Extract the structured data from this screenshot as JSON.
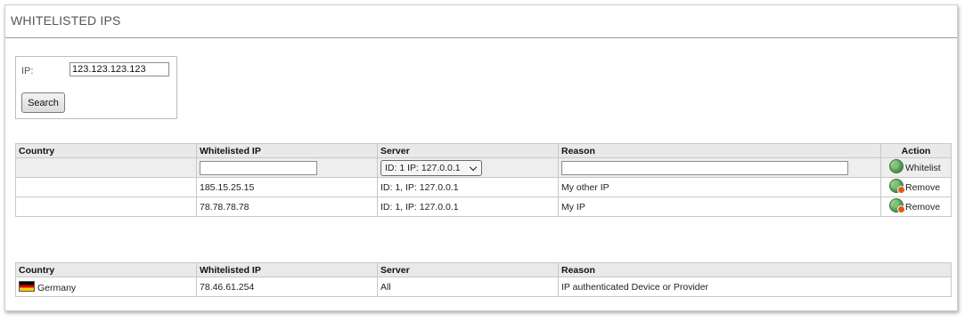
{
  "panel": {
    "title": "WHITELISTED IPS"
  },
  "search": {
    "ip_label": "IP:",
    "ip_value": "123.123.123.123",
    "button_label": "Search"
  },
  "whitelist_table": {
    "headers": {
      "country": "Country",
      "ip": "Whitelisted IP",
      "server": "Server",
      "reason": "Reason",
      "action": "Action"
    },
    "filter_row": {
      "ip_value": "",
      "server_selected": "ID: 1 IP: 127.0.0.1",
      "reason_value": "",
      "action_label": "Whitelist"
    },
    "rows": [
      {
        "country": "",
        "ip": "185.15.25.15",
        "server": "ID: 1, IP: 127.0.0.1",
        "reason": "My other IP",
        "action_label": "Remove"
      },
      {
        "country": "",
        "ip": "78.78.78.78",
        "server": "ID: 1, IP: 127.0.0.1",
        "reason": "My IP",
        "action_label": "Remove"
      }
    ]
  },
  "global_table": {
    "headers": {
      "country": "Country",
      "ip": "Whitelisted IP",
      "server": "Server",
      "reason": "Reason"
    },
    "rows": [
      {
        "country": "Germany",
        "flag": "germany-flag",
        "ip": "78.46.61.254",
        "server": "All",
        "reason": "IP authenticated Device or Provider"
      }
    ]
  },
  "colors": {
    "header_bg": "#e9e9e9",
    "filter_bg": "#eeeeee",
    "border": "#c8c8c8"
  }
}
